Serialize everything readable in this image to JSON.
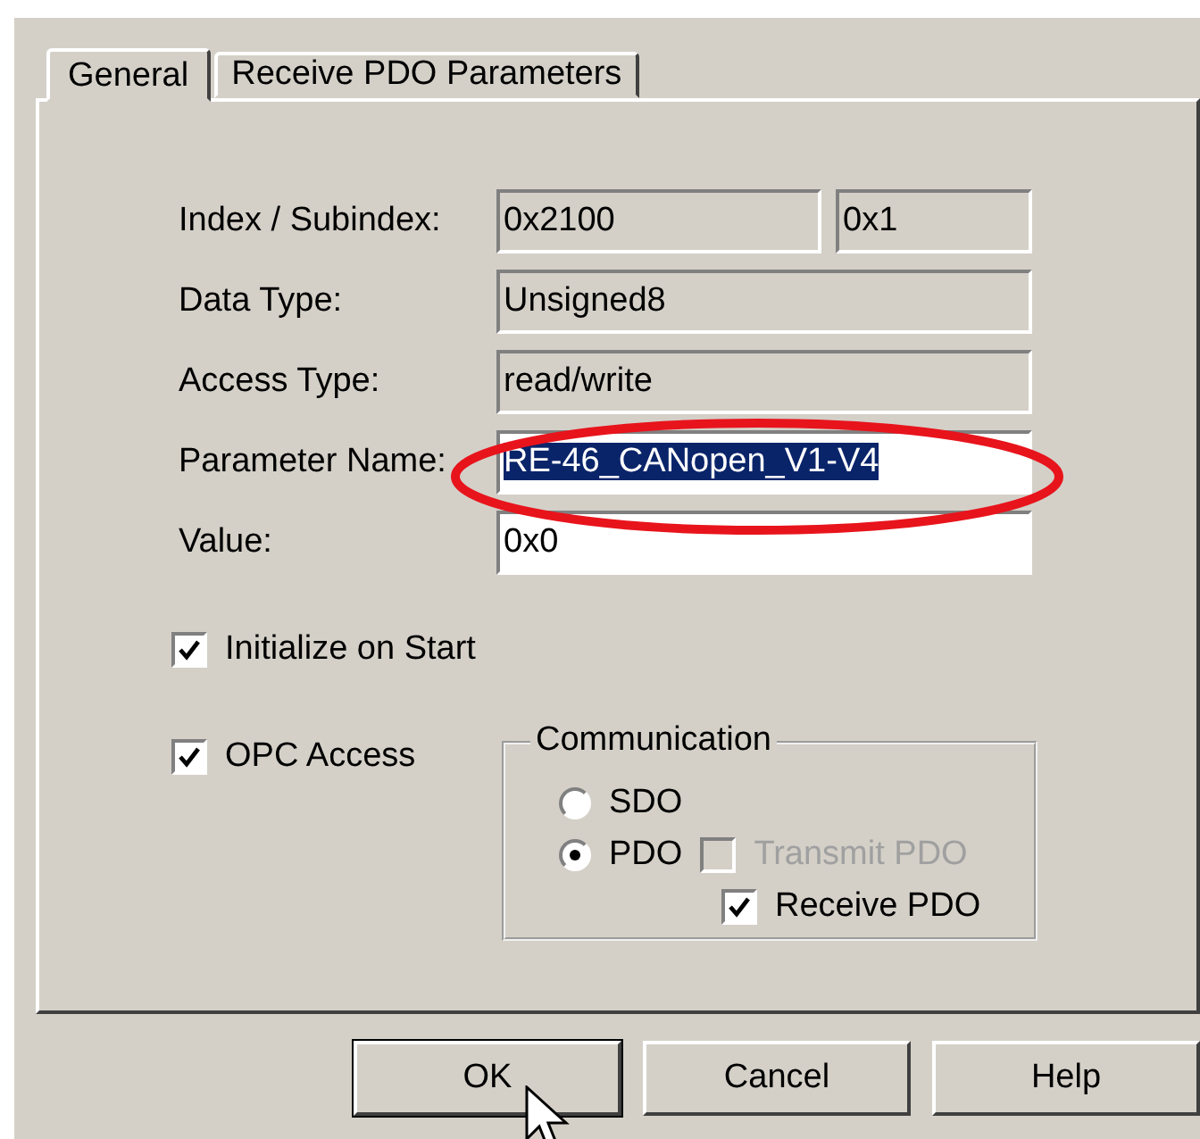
{
  "tabs": [
    {
      "label": "General",
      "selected": true
    },
    {
      "label": "Receive PDO Parameters",
      "selected": false
    }
  ],
  "fields": [
    {
      "label": "Index / Subindex:",
      "values": [
        "0x2100",
        "0x1"
      ],
      "readonly": true,
      "text_selected": false
    },
    {
      "label": "Data Type:",
      "values": [
        "Unsigned8"
      ],
      "readonly": true,
      "text_selected": false
    },
    {
      "label": "Access Type:",
      "values": [
        "read/write"
      ],
      "readonly": true,
      "text_selected": false
    },
    {
      "label": "Parameter Name:",
      "values": [
        "RE-46_CANopen_V1-V4"
      ],
      "readonly": false,
      "text_selected": true
    },
    {
      "label": "Value:",
      "values": [
        "0x0"
      ],
      "readonly": false,
      "text_selected": false
    }
  ],
  "initialize_on_start": {
    "label": "Initialize on Start",
    "checked": true
  },
  "opc_access": {
    "label": "OPC Access",
    "checked": true
  },
  "communication": {
    "title": "Communication",
    "radios": [
      {
        "label": "SDO",
        "selected": false
      },
      {
        "label": "PDO",
        "selected": true
      }
    ],
    "options": [
      {
        "label": "Transmit PDO",
        "checked": false,
        "disabled": true
      },
      {
        "label": "Receive PDO",
        "checked": true,
        "disabled": false
      }
    ]
  },
  "buttons": [
    "OK",
    "Cancel",
    "Help"
  ]
}
